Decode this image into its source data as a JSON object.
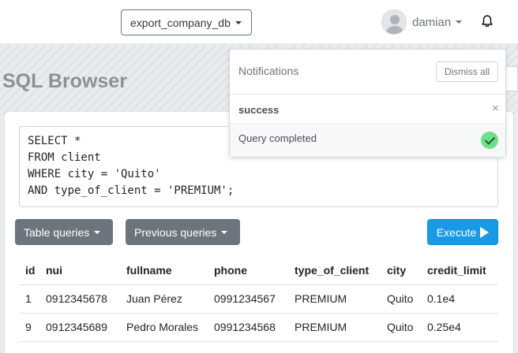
{
  "header": {
    "database": "export_company_db",
    "username": "damian"
  },
  "page": {
    "title": "SQL Browser"
  },
  "query": {
    "lines": [
      "SELECT *",
      "FROM client",
      "WHERE city = 'Quito'",
      "AND type_of_client = 'PREMIUM';"
    ]
  },
  "buttons": {
    "table_queries": "Table queries",
    "previous_queries": "Previous queries",
    "execute": "Execute"
  },
  "results": {
    "columns": [
      "id",
      "nui",
      "fullname",
      "phone",
      "type_of_client",
      "city",
      "credit_limit"
    ],
    "rows": [
      [
        "1",
        "0912345678",
        "Juan Pérez",
        "0991234567",
        "PREMIUM",
        "Quito",
        "0.1e4"
      ],
      [
        "9",
        "0912345689",
        "Pedro Morales",
        "0991234568",
        "PREMIUM",
        "Quito",
        "0.25e4"
      ]
    ]
  },
  "notifications": {
    "title": "Notifications",
    "dismiss_all": "Dismiss all",
    "toast": {
      "title": "success",
      "message": "Query completed",
      "close": "×"
    }
  },
  "colors": {
    "primary": "#1a9ae6",
    "secondary": "#6c757d",
    "success": "#6ee08a"
  },
  "icons": {
    "bell": "bell-icon",
    "check": "check-circle-icon",
    "play": "play-icon",
    "avatar": "user-avatar-icon"
  }
}
